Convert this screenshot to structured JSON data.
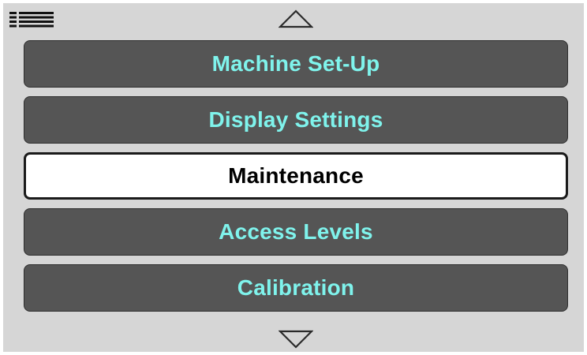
{
  "icons": {
    "menu": "menu-list-icon",
    "scroll_up": "triangle-up-icon",
    "scroll_down": "triangle-down-icon"
  },
  "colors": {
    "background": "#d6d6d6",
    "button_fill": "#555555",
    "button_text": "#7ff3ec",
    "selected_fill": "#ffffff",
    "selected_text": "#000000"
  },
  "menu": {
    "items": [
      {
        "label": "Machine Set-Up",
        "selected": false
      },
      {
        "label": "Display Settings",
        "selected": false
      },
      {
        "label": "Maintenance",
        "selected": true
      },
      {
        "label": "Access Levels",
        "selected": false
      },
      {
        "label": "Calibration",
        "selected": false
      }
    ]
  }
}
